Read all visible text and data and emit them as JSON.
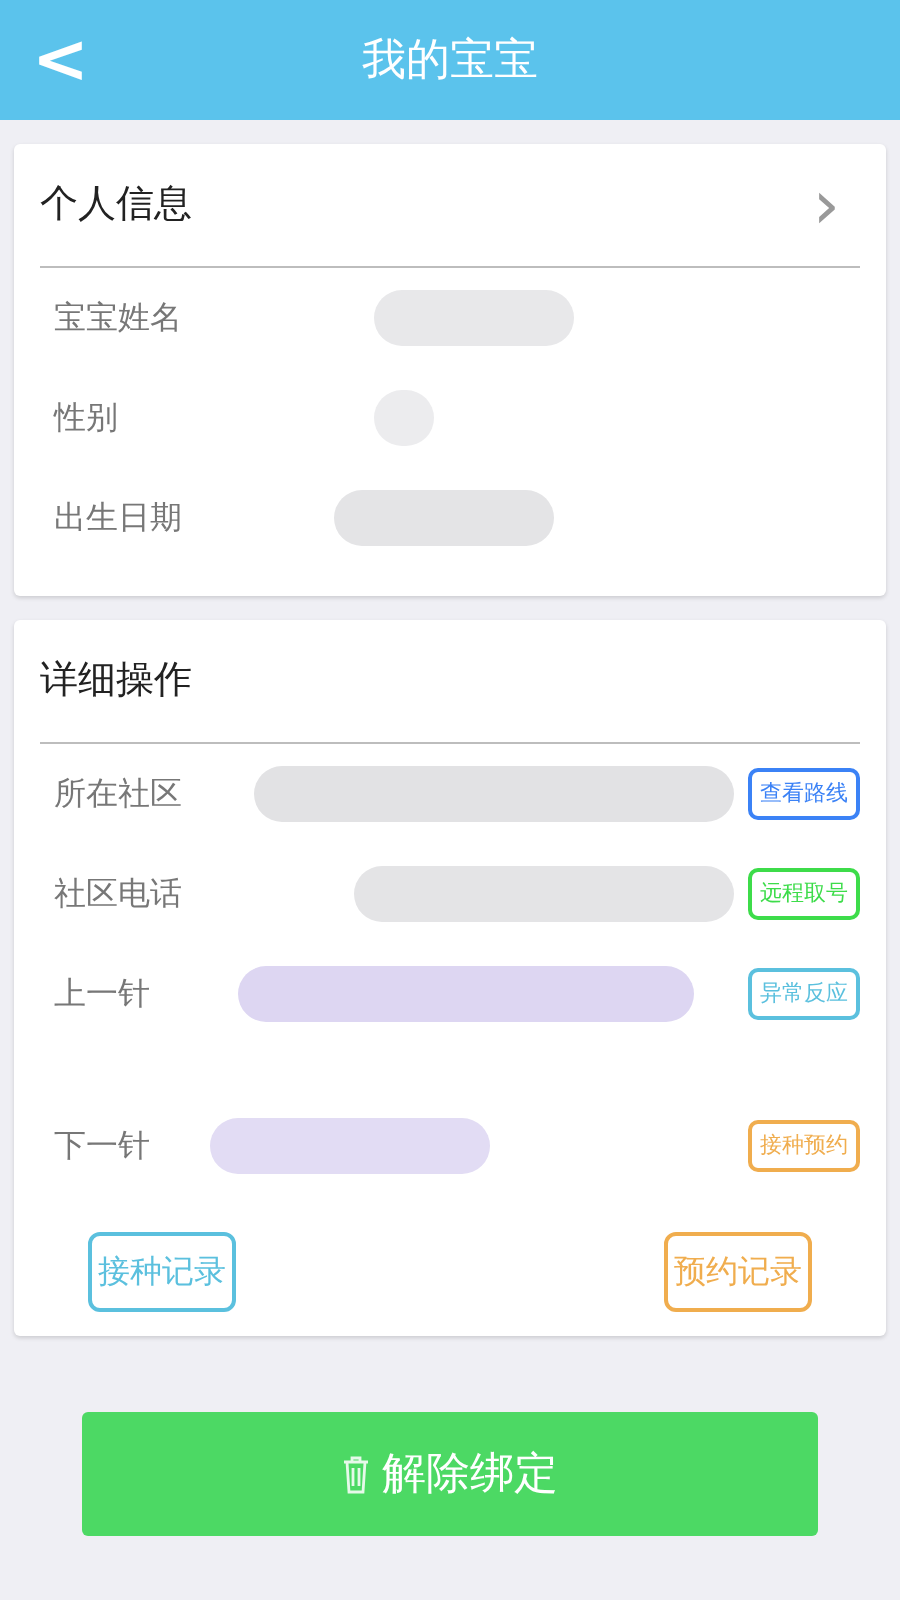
{
  "header": {
    "back": "<",
    "title": "我的宝宝"
  },
  "personal_info": {
    "title": "个人信息",
    "chevron": "›",
    "rows": [
      {
        "label": "宝宝姓名",
        "color": "#e8e8ea"
      },
      {
        "label": "性别",
        "color": "#ececee"
      },
      {
        "label": "出生日期",
        "color": "#e4e4e6"
      }
    ]
  },
  "details": {
    "title": "详细操作",
    "rows": [
      {
        "label": "所在社区",
        "color": "#e2e2e4",
        "action": {
          "label": "查看路线",
          "color": "#3b82f6"
        }
      },
      {
        "label": "社区电话",
        "color": "#e4e4e6",
        "action": {
          "label": "远程取号",
          "color": "#3ddc4a"
        }
      },
      {
        "label": "上一针",
        "color": "#ddd6f2",
        "action": {
          "label": "异常反应",
          "color": "#5bc0de"
        }
      },
      {
        "label": "下一针",
        "color": "#e2dcf4",
        "action": {
          "label": "接种预约",
          "color": "#f0ad4e"
        }
      }
    ],
    "buttons": [
      {
        "label": "接种记录",
        "color": "#5bc0de"
      },
      {
        "label": "预约记录",
        "color": "#f0ad4e"
      }
    ]
  },
  "unbind_button": {
    "label": "解除绑定"
  }
}
